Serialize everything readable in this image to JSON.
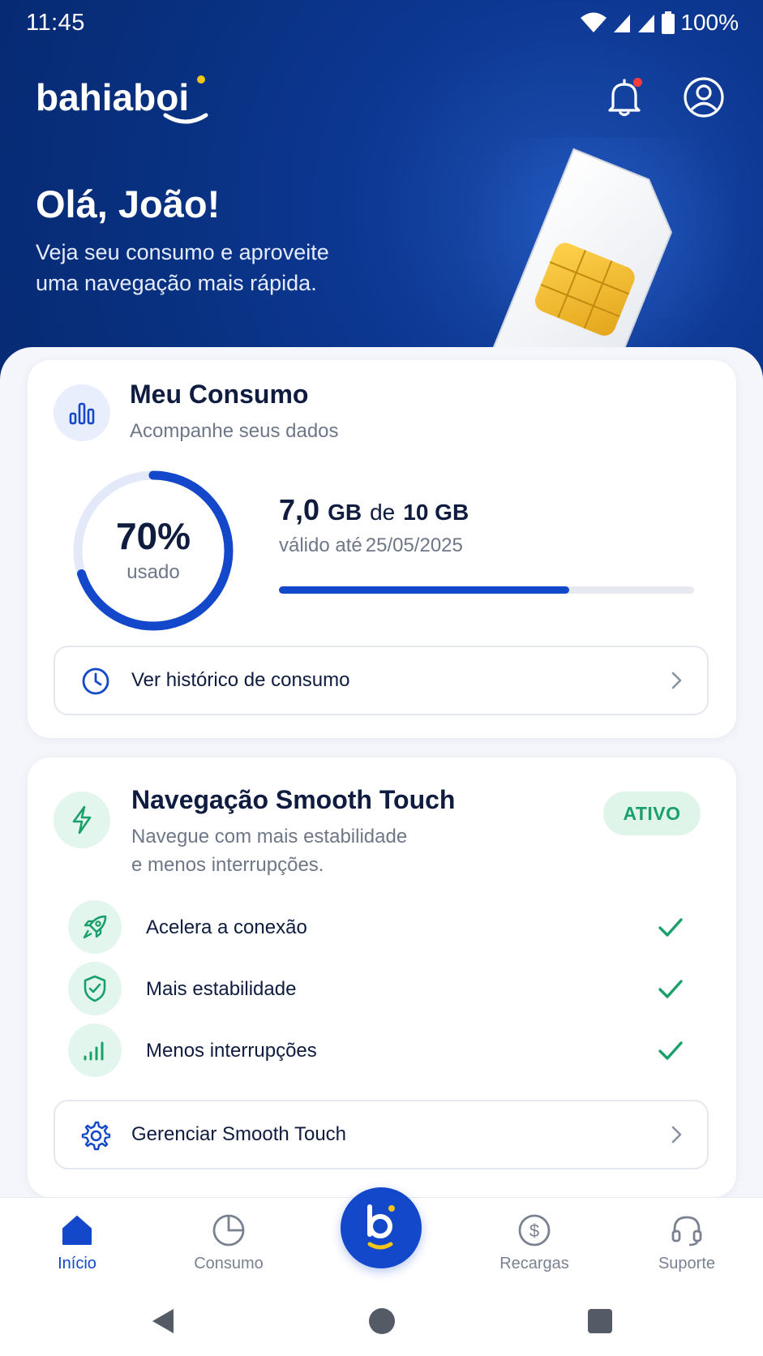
{
  "status_bar": {
    "time": "11:45",
    "battery": "100%"
  },
  "header": {
    "logo_text": "bahiaboi",
    "greeting": "Olá, João!",
    "subtitle": "Veja seu consumo e aproveite uma navegação mais rápida."
  },
  "consumo_card": {
    "title": "Meu Consumo",
    "subtitle": "Acompanhe seus dados",
    "percent_label": "70%",
    "percent_value": 0.7,
    "used_label": "usado",
    "used_amount": "7,0",
    "used_unit": "GB",
    "of_label": "de",
    "total_amount": "10 GB",
    "valid_label": "válido até",
    "valid_date": "25/05/2025",
    "history_label": "Ver histórico de consumo"
  },
  "smooth_card": {
    "title": "Navegação Smooth Touch",
    "subtitle_line1": "Navegue com mais estabilidade",
    "subtitle_line2": "e menos interrupções.",
    "status_badge": "ATIVO",
    "features": [
      {
        "label": "Acelera a conexão",
        "icon": "rocket-icon"
      },
      {
        "label": "Mais estabilidade",
        "icon": "shield-check-icon"
      },
      {
        "label": "Menos interrupções",
        "icon": "signal-bars-icon"
      }
    ],
    "manage_label": "Gerenciar Smooth Touch"
  },
  "bottom_nav": {
    "items": [
      {
        "label": "Início",
        "icon": "home-icon",
        "active": true
      },
      {
        "label": "Consumo",
        "icon": "pie-chart-icon",
        "active": false
      },
      {
        "label": "Recargas",
        "icon": "dollar-circle-icon",
        "active": false
      },
      {
        "label": "Suporte",
        "icon": "headset-icon",
        "active": false
      }
    ],
    "center_icon": "bahiaboi-b-logo-icon"
  },
  "colors": {
    "primary": "#1248c9",
    "hero_bg": "#08307f",
    "success": "#1aa06a",
    "notification_dot": "#ff3b3b"
  }
}
